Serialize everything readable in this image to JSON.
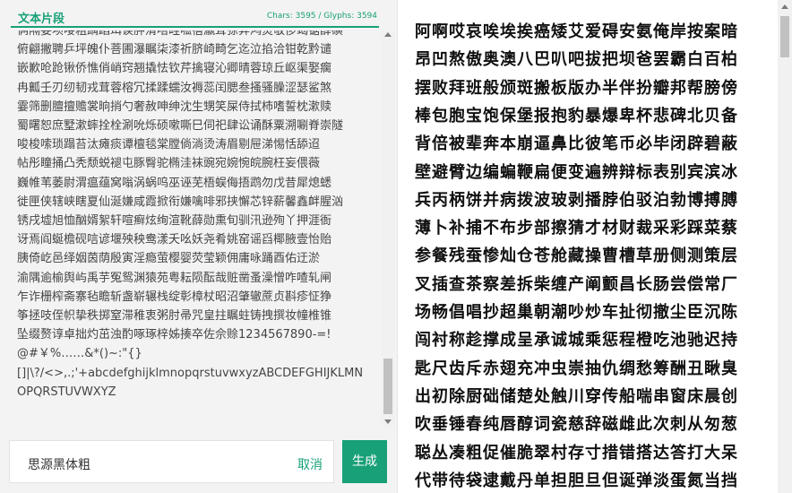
{
  "header": {
    "title": "文本片段",
    "counts": "Chars: 3595 / Glyphs: 3594"
  },
  "text_lines": [
    "俩隔娄坝喽粗踽蹈珥诶胛渭唔畦呱蓓瀛茸弶弊鸿熨敬侈竭锯薛磺",
    "俯翩撇聘乒坪魄仆菩圃瀑瞩柒漆祈脐崎畸乞迄泣掐洽钳乾黔谴",
    "嵌歉呛跄锹侨憔俏峭窍翘撬怯钦芹擒寝沁卿晴蓉琼丘岖渠娶瘸",
    "冉瓤壬刃纫韧戎茸蓉榕冗揉蹂蠕汝褥蕊闰腮叁搔骚臊涩瑟鲨煞",
    "霎筛删膻擅赡裳晌捎勺奢赦呻绅沈生甥笑屎侍拭柿嗜誓枕漱赎",
    "蜀曙恕庶墅漱蟀拴栓涮吮烁硕嗽嘶巳伺祀肆讼诵酥粟溯唰脊崇隧",
    "唆梭嗦琐蹋苔汰瘫痰谭檀毯棠膛倘淌烫涛眉剔屉涕惕恬舔迢",
    "帖彤瞳捅凸秃颓蜕褪屯豚臀驼椭洼袜豌宛婉惋皖腕枉妄偎薇",
    "巍帷苇萎尉渭瘟蕴窝嗡涡蜗呜巫诬芜梧蜈侮捂鹉勿戊昔犀熄蟋",
    "徙匣侠辖峡瞎夏仙涎嫌咸霞掀衔嫌噙啡邪挟懈芯锌薪馨鑫衅腥汹",
    "锈戌墟旭恤酗婿絮轩喧癣炫绚渲靴薛勋熏旬驯汛逊殉丫押涯衙",
    "讶焉阎蜒檐砚唁谚堰殃秧鸯漾夭吆妖尧肴姚窑谣舀椰腋壹怡贻",
    "胰倚屹邑绎姻茵荫殷寅淫瘾萤樱婴荧莹颖佣庸咏踊酉佑迂淤",
    "渝隅逾榆舆屿禹芋冤鸳渊猿苑粤耘陨酝哉赃凿蚤澡憎咋喳轧闸",
    "乍诈栅榨斋寨毡瞻斩盏崭辗栈绽彰樟杖昭沼肇辙蔗贞斟疹怔狰",
    "筝拯吱侄帜挚秩掷窒滞稚衷粥肘帚咒皇拄瞩蛀铸拽撰妆幢椎锥",
    "坠缀赘谆卓拙灼茁浊酌啄琢梓姊揍卒佐佘赊1234567890-=!",
    "@#￥%……&*()~:\"{}",
    "[]|\\?/<>,.;'+abcdefghijklmnopqrstuvwxyzABCDEFGHIJKLMN",
    "OPQRSTUVWXYZ"
  ],
  "input": {
    "font_name": "思源黑体粗",
    "cancel_label": "取消",
    "generate_label": "生成"
  },
  "preview_lines": [
    "阿啊哎哀唉埃挨癌矮艾爱碍安氨俺岸按案暗",
    "昂凹熬傲奥澳八巴叭吧拔把坝爸罢霸白百柏",
    "摆败拜班般颁斑搬板版办半伴扮瓣邦帮膀傍",
    "棒包胞宝饱保堡报抱豹暴爆卑杯悲碑北贝备",
    "背倍被辈奔本崩逼鼻比彼笔币必毕闭辟碧蔽",
    "壁避臂边编蝙鞭扁便变遍辨辩标表别宾滨冰",
    "兵丙柄饼并病拨波玻剥播脖伯驳泊勃博搏膊",
    "薄卜补捕不布步部擦猜才材财裁采彩踩菜蔡",
    "参餐残蚕惨灿仓苍舱藏操曹槽草册侧测策层",
    "叉插查茶察差拆柴缠产阐颤昌长肠尝偿常厂",
    "场畅倡唱抄超巢朝潮吵炒车扯彻撤尘臣沉陈",
    "闯衬称趁撑成呈承诚城乘惩程橙吃池驰迟持",
    "匙尺齿斥赤翅充冲虫崇抽仇绸愁筹酬丑瞅臭",
    "出初除厨础储楚处触川穿传船喘串窗床晨创",
    "吹垂锤春纯唇醇词瓷慈辞磁雌此次刺从匆葱",
    "聪丛凑粗促催脆翠村存寸措错搭达答打大呆",
    "代带待袋逮戴丹单担胆旦但诞弹淡蛋氮当挡"
  ]
}
